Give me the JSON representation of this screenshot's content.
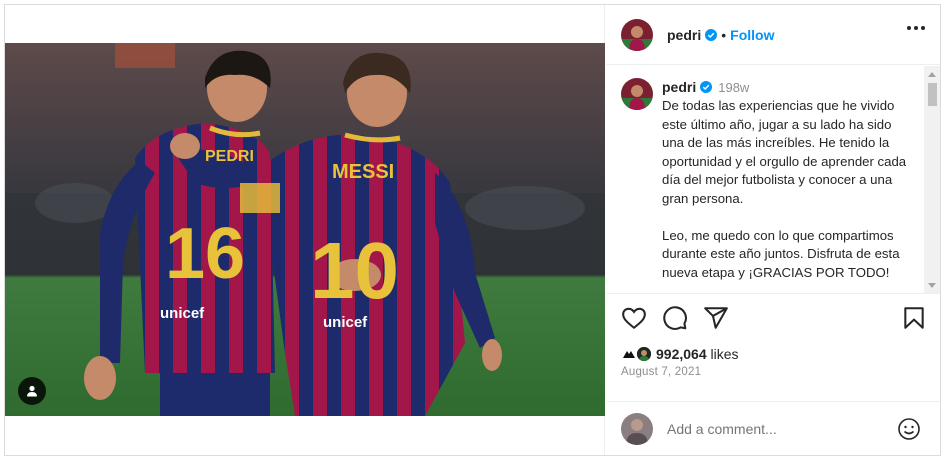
{
  "post": {
    "author": "pedri",
    "follow_label": "Follow",
    "separator": "•",
    "caption": {
      "author": "pedri",
      "time": "198w",
      "text": "De todas las experiencias que he vivido este último año, jugar a su lado ha sido una de las más increíbles. He tenido la oportunidad y el orgullo de aprender cada día del mejor futbolista y conocer a una gran persona.\n\nLeo, me quedo con lo que compartimos durante este año juntos. Disfruta de esta nueva etapa y ¡GRACIAS POR TODO!"
    },
    "likes_count": "992,064",
    "likes_suffix": " likes",
    "date": "August 7, 2021"
  },
  "photo": {
    "jersey_left_number": "16",
    "jersey_left_name": "PEDRI",
    "jersey_right_number": "10",
    "jersey_right_name": "MESSI",
    "sponsor": "unicef"
  },
  "comment_box": {
    "placeholder": "Add a comment..."
  },
  "colors": {
    "accent": "#0095f6",
    "text": "#262626",
    "muted": "#8e8e8e",
    "border": "#dbdbdb"
  },
  "icons": [
    "user-tag-icon",
    "verified-icon",
    "more-options-icon",
    "heart-icon",
    "comment-icon",
    "share-icon",
    "bookmark-icon",
    "emoji-icon"
  ]
}
